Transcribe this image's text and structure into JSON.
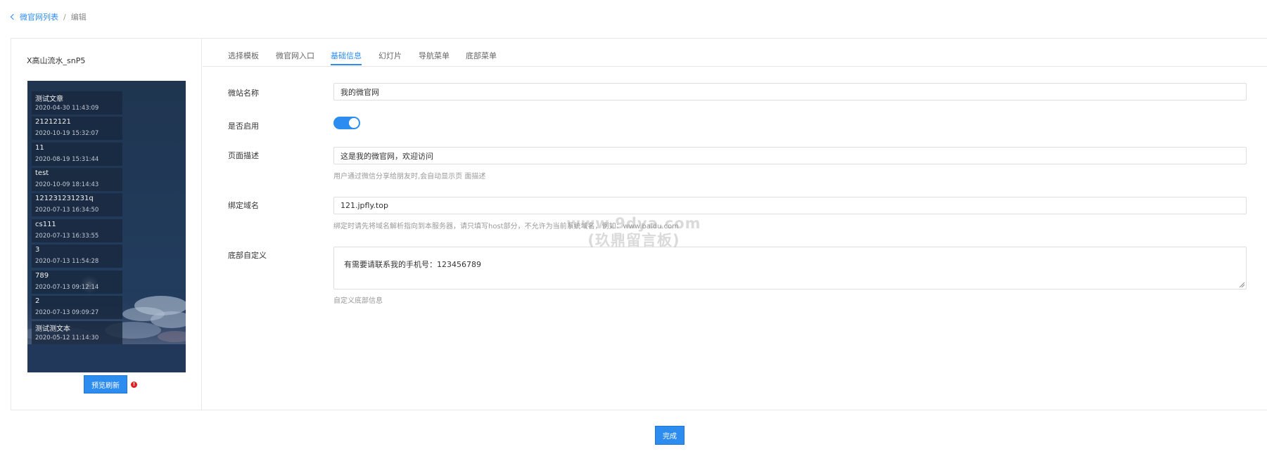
{
  "breadcrumb": {
    "back_label": "微官网列表",
    "separator": "/",
    "current": "编辑"
  },
  "template": {
    "name": "X高山流水_snP5"
  },
  "preview": {
    "articles": [
      {
        "title": "测试文章",
        "date": "2020-04-30 11:43:09"
      },
      {
        "title": "21212121",
        "date": "2020-10-19 15:32:07"
      },
      {
        "title": "11",
        "date": "2020-08-19 15:31:44"
      },
      {
        "title": "test",
        "date": "2020-10-09 18:14:43"
      },
      {
        "title": "121231231231q",
        "date": "2020-07-13 16:34:50"
      },
      {
        "title": "cs111",
        "date": "2020-07-13 16:33:55"
      },
      {
        "title": "3",
        "date": "2020-07-13 11:54:28"
      },
      {
        "title": "789",
        "date": "2020-07-13 09:12:14"
      },
      {
        "title": "2",
        "date": "2020-07-13 09:09:27"
      },
      {
        "title": "测试测文本",
        "date": "2020-05-12 11:14:30"
      }
    ],
    "refresh_label": "预览刷新",
    "info_icon": "!"
  },
  "tabs": [
    {
      "label": "选择模板"
    },
    {
      "label": "微官网入口"
    },
    {
      "label": "基础信息"
    },
    {
      "label": "幻灯片"
    },
    {
      "label": "导航菜单"
    },
    {
      "label": "底部菜单"
    }
  ],
  "active_tab": 2,
  "form": {
    "site_name": {
      "label": "微站名称",
      "value": "我的微官网"
    },
    "enabled": {
      "label": "是否启用",
      "on": true
    },
    "description": {
      "label": "页面描述",
      "value": "这是我的微官网，欢迎访问",
      "hint": "用户通过微信分享给朋友时,会自动显示页 面描述"
    },
    "domain": {
      "label": "绑定域名",
      "value": "121.jpfly.top",
      "hint": "绑定时请先将域名解析指向到本服务器，请只填写host部分，不允许为当前系统域名，例如：www.baidu.com"
    },
    "footer": {
      "label": "底部自定义",
      "value": "有需要请联系我的手机号：123456789",
      "hint": "自定义底部信息"
    }
  },
  "watermark": {
    "line1": "www.9dya.com",
    "line2": "(玖鼎留言板)"
  },
  "done_label": "完成",
  "colors": {
    "accent": "#2d8cf0",
    "danger": "#e02020"
  }
}
